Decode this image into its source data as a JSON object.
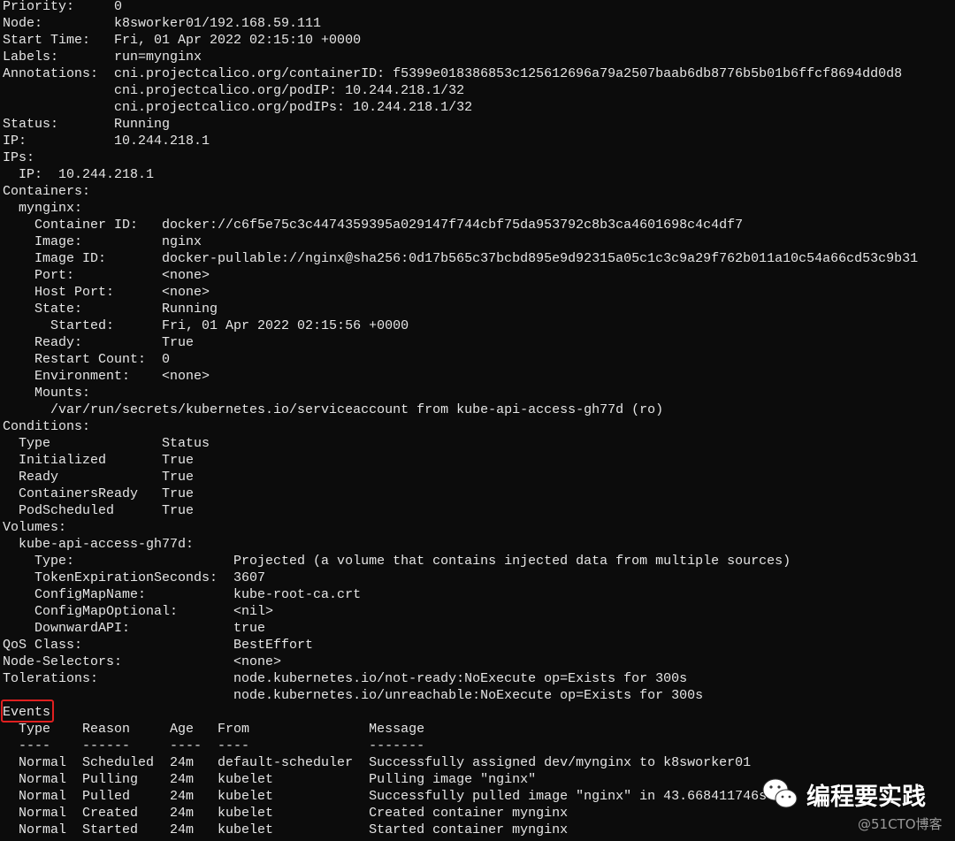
{
  "describe_lines": [
    "Priority:     0",
    "Node:         k8sworker01/192.168.59.111",
    "Start Time:   Fri, 01 Apr 2022 02:15:10 +0000",
    "Labels:       run=mynginx",
    "Annotations:  cni.projectcalico.org/containerID: f5399e018386853c125612696a79a2507baab6db8776b5b01b6ffcf8694dd0d8",
    "              cni.projectcalico.org/podIP: 10.244.218.1/32",
    "              cni.projectcalico.org/podIPs: 10.244.218.1/32",
    "Status:       Running",
    "IP:           10.244.218.1",
    "IPs:",
    "  IP:  10.244.218.1",
    "Containers:",
    "  mynginx:",
    "    Container ID:   docker://c6f5e75c3c4474359395a029147f744cbf75da953792c8b3ca4601698c4c4df7",
    "    Image:          nginx",
    "    Image ID:       docker-pullable://nginx@sha256:0d17b565c37bcbd895e9d92315a05c1c3c9a29f762b011a10c54a66cd53c9b31",
    "    Port:           <none>",
    "    Host Port:      <none>",
    "    State:          Running",
    "      Started:      Fri, 01 Apr 2022 02:15:56 +0000",
    "    Ready:          True",
    "    Restart Count:  0",
    "    Environment:    <none>",
    "    Mounts:",
    "      /var/run/secrets/kubernetes.io/serviceaccount from kube-api-access-gh77d (ro)",
    "Conditions:",
    "  Type              Status",
    "  Initialized       True",
    "  Ready             True",
    "  ContainersReady   True",
    "  PodScheduled      True",
    "Volumes:",
    "  kube-api-access-gh77d:",
    "    Type:                    Projected (a volume that contains injected data from multiple sources)",
    "    TokenExpirationSeconds:  3607",
    "    ConfigMapName:           kube-root-ca.crt",
    "    ConfigMapOptional:       <nil>",
    "    DownwardAPI:             true",
    "QoS Class:                   BestEffort",
    "Node-Selectors:              <none>",
    "Tolerations:                 node.kubernetes.io/not-ready:NoExecute op=Exists for 300s",
    "                             node.kubernetes.io/unreachable:NoExecute op=Exists for 300s"
  ],
  "events": {
    "title": "Events",
    "header": "  Type    Reason     Age   From               Message",
    "divider": "  ----    ------     ----  ----               -------",
    "rows": [
      "  Normal  Scheduled  24m   default-scheduler  Successfully assigned dev/mynginx to k8sworker01",
      "  Normal  Pulling    24m   kubelet            Pulling image \"nginx\"",
      "  Normal  Pulled     24m   kubelet            Successfully pulled image \"nginx\" in 43.668411746s",
      "  Normal  Created    24m   kubelet            Created container mynginx",
      "  Normal  Started    24m   kubelet            Started container mynginx"
    ],
    "highlight_color": "#e02020"
  },
  "watermark": {
    "icon": "wechat-icon",
    "name": "编程要实践",
    "source": "@51CTO博客"
  },
  "colors": {
    "background": "#0c0c0c",
    "text": "#e6e6e6"
  }
}
